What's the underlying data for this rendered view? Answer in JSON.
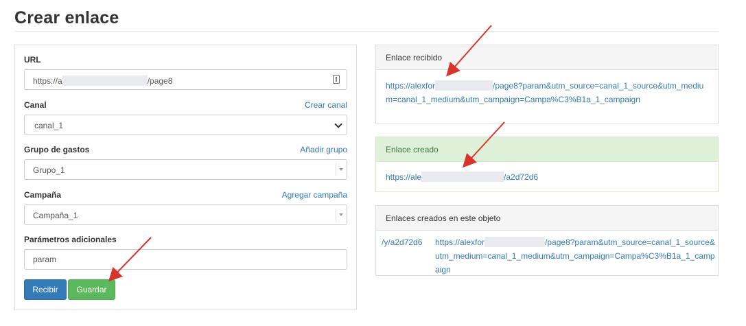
{
  "page": {
    "title": "Crear enlace"
  },
  "form": {
    "url_label": "URL",
    "url_prefix": "https://a",
    "url_suffix": "/page8",
    "canal_label": "Canal",
    "canal_link": "Crear canal",
    "canal_value": "canal_1",
    "grupo_label": "Grupo de gastos",
    "grupo_link": "Añadir grupo",
    "grupo_value": "Grupo_1",
    "campana_label": "Campaña",
    "campana_link": "Agregar campaña",
    "campana_value": "Campaña_1",
    "params_label": "Parámetros adicionales",
    "params_value": "param",
    "recibir_label": "Recibir",
    "guardar_label": "Guardar"
  },
  "received": {
    "header": "Enlace recibido",
    "prefix": "https://alexfor",
    "suffix": "/page8?param&utm_source=canal_1_source&utm_medium=canal_1_medium&utm_campaign=Campa%C3%B1a_1_campaign"
  },
  "created": {
    "header": "Enlace creado",
    "prefix": "https://ale",
    "suffix": "/a2d72d6"
  },
  "object_links": {
    "header": "Enlaces creados en este objeto",
    "short": "/y/a2d72d6",
    "prefix": "https://alexfor",
    "suffix": "/page8?param&utm_source=canal_1_source&utm_medium=canal_1_medium&utm_campaign=Campa%C3%B1a_1_campaign"
  },
  "colors": {
    "primary": "#337ab7",
    "success": "#5cb85c",
    "success_bg": "#dff0d8",
    "arrow": "#d9342b"
  }
}
